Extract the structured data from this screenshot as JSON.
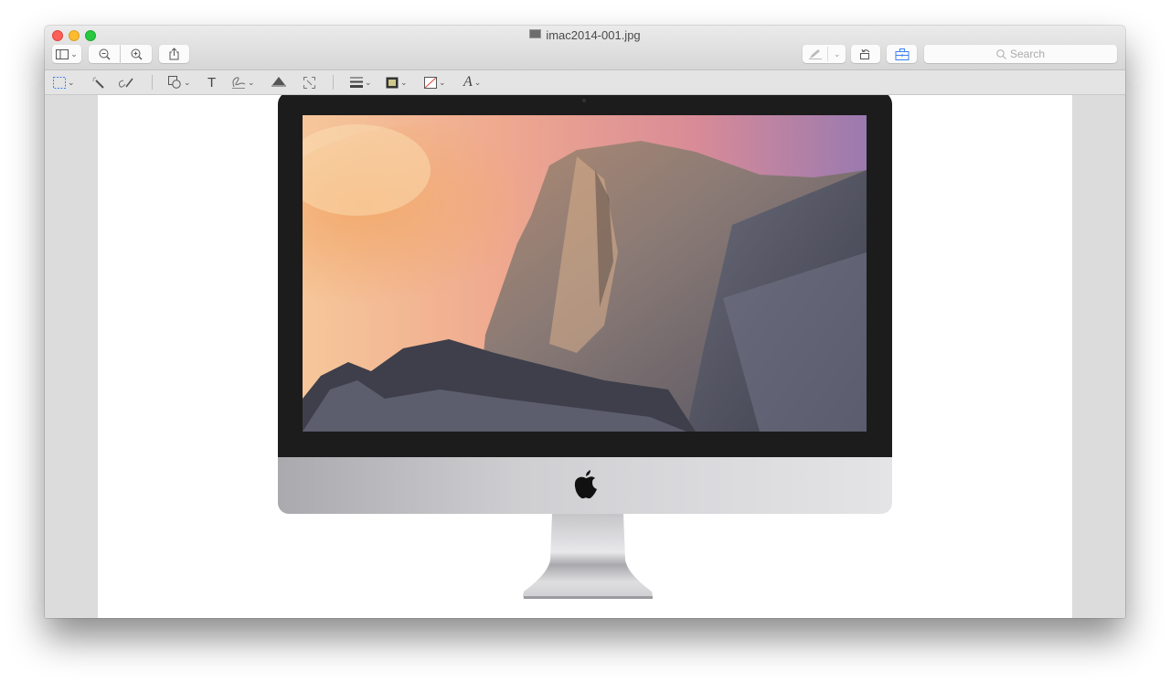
{
  "window": {
    "title": "imac2014-001.jpg",
    "traffic_lights": [
      "close",
      "minimize",
      "zoom"
    ]
  },
  "toolbar": {
    "left_buttons": [
      {
        "name": "sidebar-toggle",
        "icon": "sidebar-icon",
        "has_dropdown": true
      },
      {
        "name": "zoom-out",
        "icon": "zoom-out-icon"
      },
      {
        "name": "zoom-in",
        "icon": "zoom-in-icon"
      },
      {
        "name": "share",
        "icon": "share-icon"
      }
    ],
    "right_buttons": [
      {
        "name": "markup-pen",
        "icon": "pen-icon",
        "has_dropdown": true
      },
      {
        "name": "rotate",
        "icon": "rotate-left-icon"
      },
      {
        "name": "markup-toolbox",
        "icon": "toolbox-icon",
        "active": true
      }
    ],
    "search": {
      "placeholder": "Search",
      "value": ""
    }
  },
  "markup_toolbar": {
    "tools": [
      {
        "name": "rectangular-selection",
        "icon": "selection-icon",
        "has_dropdown": true,
        "active": true
      },
      {
        "name": "instant-alpha",
        "icon": "magic-wand-icon"
      },
      {
        "name": "sketch",
        "icon": "sketch-icon"
      },
      {
        "name": "shapes",
        "icon": "shapes-icon",
        "has_dropdown": true
      },
      {
        "name": "text",
        "icon": "text-icon",
        "glyph": "T"
      },
      {
        "name": "sign",
        "icon": "signature-icon",
        "has_dropdown": true
      },
      {
        "name": "adjust-color",
        "icon": "adjust-color-icon"
      },
      {
        "name": "adjust-size",
        "icon": "adjust-size-icon"
      },
      {
        "name": "shape-style",
        "icon": "line-style-icon",
        "has_dropdown": true
      },
      {
        "name": "border-color",
        "icon": "border-color-icon",
        "has_dropdown": true
      },
      {
        "name": "fill-color",
        "icon": "fill-color-icon",
        "has_dropdown": true
      },
      {
        "name": "text-style",
        "icon": "text-style-icon",
        "glyph": "A",
        "has_dropdown": true
      }
    ]
  },
  "document": {
    "image_subject": "iMac with Yosemite wallpaper (Half Dome at sunset)",
    "accent_color": "#3b82f6"
  }
}
